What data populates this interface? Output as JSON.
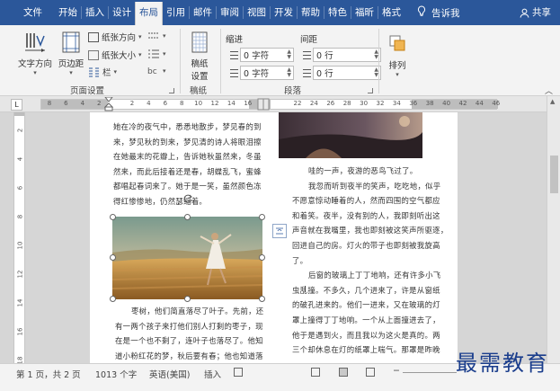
{
  "tabs": [
    "文件",
    "开始",
    "插入",
    "设计",
    "布局",
    "引用",
    "邮件",
    "审阅",
    "视图",
    "开发",
    "帮助",
    "特色",
    "福昕",
    "格式"
  ],
  "active_tab": "布局",
  "tell_me": "告诉我",
  "share": "共享",
  "ribbon": {
    "text_direction": "文字方向",
    "margins": "页边距",
    "orientation": "纸张方向",
    "size": "纸张大小",
    "columns": "栏",
    "page_setup_group": "页面设置",
    "draft_paper": "稿纸\n设置",
    "draft_group": "稿纸",
    "indent_header": "缩进",
    "spacing_header": "间距",
    "indent_left": "0 字符",
    "indent_right": "0 字符",
    "spacing_before": "0 行",
    "spacing_after": "0 行",
    "paragraph_group": "段落",
    "arrange": "排列"
  },
  "ruler": {
    "corner": "L",
    "h_numbers": [
      "8",
      "6",
      "4",
      "2",
      "",
      "2",
      "4",
      "6",
      "8",
      "10",
      "12",
      "14",
      "16",
      "",
      "",
      "22",
      "24",
      "26",
      "28",
      "30",
      "32",
      "34",
      "36",
      "38",
      "40",
      "42",
      "44",
      "46"
    ],
    "v_numbers": [
      "2",
      "4",
      "6",
      "8",
      "10",
      "12",
      "14",
      "16",
      "18"
    ]
  },
  "document": {
    "left_col_top": [
      "她在冷的夜气中，悉悉地散步，梦见春的到",
      "来，梦见秋的到来，梦见清的诗人将眼泪擦",
      "在她最末的花瓣上，告诉她秋虽然来，冬虽",
      "然来，而此后接着还是春，胡蝶乱飞，蜜蜂",
      "都唱起春词来了。她于是一笑，虽然颜色冻",
      "得红惨惨地，仍然瑟缩着。"
    ],
    "left_col_bottom": [
      "枣树，他们简直落尽了叶子。先前，还",
      "有一两个孩子来打他们别人打剩的枣子，现",
      "在是一个也不剩了，连叶子也落尽了。他知",
      "道小粉红花的梦，秋后要有春；他也知道落"
    ],
    "right_col": [
      "哇的一声，夜游的恶鸟飞过了。",
      "我忽而听到夜半的笑声，吃吃地，似乎",
      "不愿意惊动睡着的人，然而四围的空气都应",
      "和着笑。夜半，没有别的人，我即刻听出这",
      "声音就在我嘴里，我也即刻被这笑声所驱逐，",
      "回进自己的房。灯火的带子也即刻被我旋高",
      "了。",
      "后窗的玻璃上丁丁地响，还有许多小飞",
      "虫乱撞。不多久，几个进来了，许是从窗纸",
      "的破孔进来的。他们一进来，又在玻璃的灯",
      "罩上撞得丁丁地响。一个从上面撞进去了，",
      "他于是遇到火，而且我以为这火是真的。两",
      "三个却休息在灯的纸罩上喘气。那罩是昨晚"
    ]
  },
  "status": {
    "page": "第 1 页，共 2 页",
    "words": "1013 个字",
    "language": "英语(美国)",
    "mode": "插入"
  },
  "watermark": "最需教育",
  "colors": {
    "brand": "#2b579a",
    "watermark": "#1a3d8c"
  }
}
